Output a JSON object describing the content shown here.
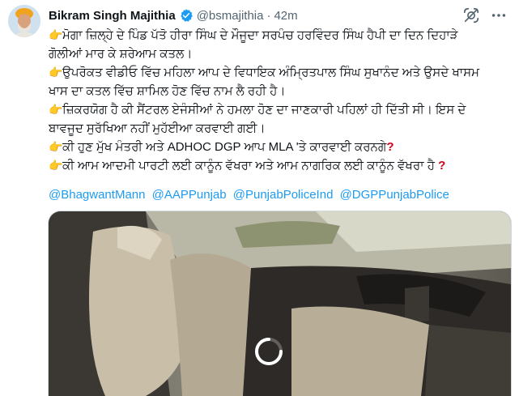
{
  "author": {
    "name": "Bikram Singh Majithia",
    "handle": "@bsmajithia",
    "separator": "·",
    "time": "42m"
  },
  "icons": {
    "verified": "verified-badge-icon",
    "hide": "hide-tweet-icon",
    "more": "more-options-icon",
    "bullet": "backhand-index-pointing-right-icon",
    "question": "red-question-mark-icon"
  },
  "colors": {
    "link": "#1d9bf0",
    "verified": "#1d9bf0",
    "question": "#d0021b",
    "muted": "#536471"
  },
  "tweet": {
    "lines": [
      "ਮੋਗਾ ਜ਼ਿਲ੍ਹੇ ਦੇ ਪਿੰਡ ਪੱਤੋ ਹੀਰਾ ਸਿੰਘ ਦੇ ਮੌਜੂਦਾ ਸਰਪੰਚ ਹਰਵਿੰਦਰ ਸਿੰਘ ਹੈਪੀ ਦਾ ਦਿਨ ਦਿਹਾੜੇ",
      "ਗੋਲੀਆਂ ਮਾਰ ਕੇ ਸ਼ਰੇਆਮ ਕਤਲ।",
      "ਉਪਰੋਕਤ ਵੀਡੀਓ ਵਿੱਚ ਮਹਿਲਾ ਆਪ ਦੇ ਵਿਧਾਇਕ ਅੰਮ੍ਰਿਤਪਾਲ ਸਿੰਘ ਸੁਖਾਨੰਦ ਅਤੇ ਉਸਦੇ ਖਾਸਮ",
      "ਖਾਸ ਦਾ ਕਤਲ ਵਿੱਚ ਸ਼ਾਮਿਲ ਹੋਣ ਵਿੱਚ ਨਾਮ ਲੈ ਰਹੀ ਹੈ।",
      "ਜ਼ਿਕਰਯੋਗ ਹੈ ਕੀ ਸੈਂਟਰਲ ਏਜੰਸੀਆਂ ਨੇ ਹਮਲਾ ਹੋਣ ਦਾ ਜਾਣਕਾਰੀ ਪਹਿਲਾਂ ਹੀ ਦਿੱਤੀ ਸੀ। ਇਸ ਦੇ",
      "ਬਾਵਜੂਦ ਸੁਰੱਖਿਆ ਨਹੀਂ ਮੁਹੱਈਆ ਕਰਵਾਈ ਗਈ।",
      "ਕੀ ਹੁਣ ਮੁੱਖ ਮੰਤਰੀ ਅਤੇ ADHOC DGP ਆਪ MLA 'ਤੇ ਕਾਰਵਾਈ ਕਰਨਗੇ",
      "ਕੀ ਆਮ ਆਦਮੀ ਪਾਰਟੀ ਲਈ ਕਾਨੂੰਨ ਵੱਖਰਾ ਅਤੇ ਆਮ ਨਾਗਰਿਕ ਲਈ ਕਾਨੂੰਨ ਵੱਖਰਾ ਹੈ"
    ],
    "bullet": "👉",
    "question": "?",
    "mentions": [
      "@BhagwantMann",
      "@AAPPunjab",
      "@PunjabPoliceInd",
      "@DGPPunjabPolice"
    ]
  },
  "media": {
    "type": "video",
    "state": "loading",
    "icon": "loading-spinner-icon"
  }
}
